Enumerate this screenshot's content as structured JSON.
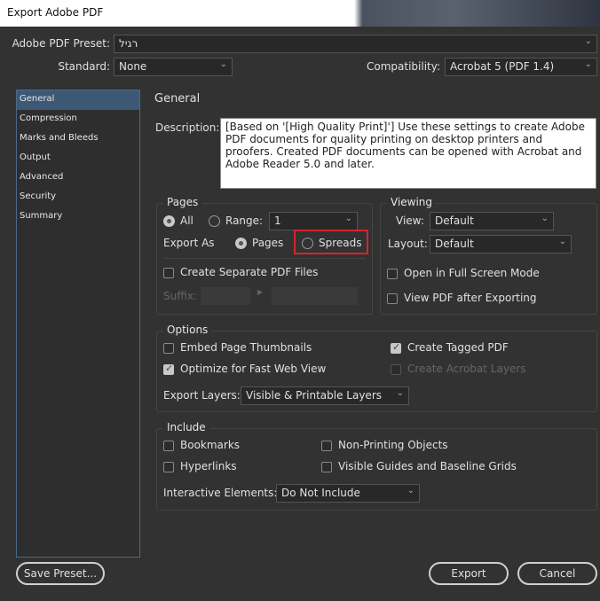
{
  "window": {
    "title": "Export Adobe PDF"
  },
  "preset": {
    "label": "Adobe PDF Preset:",
    "value": "רגיל"
  },
  "standard": {
    "label": "Standard:",
    "value": "None"
  },
  "compatibility": {
    "label": "Compatibility:",
    "value": "Acrobat 5 (PDF 1.4)"
  },
  "sidebar": {
    "items": [
      {
        "label": "General",
        "selected": true
      },
      {
        "label": "Compression"
      },
      {
        "label": "Marks and Bleeds"
      },
      {
        "label": "Output"
      },
      {
        "label": "Advanced"
      },
      {
        "label": "Security"
      },
      {
        "label": "Summary"
      }
    ]
  },
  "general": {
    "heading": "General",
    "description_label": "Description:",
    "description": "[Based on '[High Quality Print]'] Use these settings to create Adobe PDF documents for quality printing on desktop printers and proofers. Created PDF documents can be opened with Acrobat and Adobe Reader 5.0 and later."
  },
  "pages": {
    "title": "Pages",
    "all": "All",
    "range": "Range:",
    "range_value": "1",
    "export_as": "Export As",
    "pages": "Pages",
    "spreads": "Spreads",
    "separate": "Create Separate PDF Files",
    "suffix": "Suffix:"
  },
  "viewing": {
    "title": "Viewing",
    "view_label": "View:",
    "view_value": "Default",
    "layout_label": "Layout:",
    "layout_value": "Default",
    "fullscreen": "Open in Full Screen Mode",
    "view_after": "View PDF after Exporting"
  },
  "options": {
    "title": "Options",
    "embed": "Embed Page Thumbnails",
    "optimize": "Optimize for Fast Web View",
    "tagged": "Create Tagged PDF",
    "acrobat_layers": "Create Acrobat Layers",
    "export_layers_label": "Export Layers:",
    "export_layers_value": "Visible & Printable Layers"
  },
  "include": {
    "title": "Include",
    "bookmarks": "Bookmarks",
    "hyperlinks": "Hyperlinks",
    "nonprinting": "Non-Printing Objects",
    "guides": "Visible Guides and Baseline Grids",
    "interactive_label": "Interactive Elements:",
    "interactive_value": "Do Not Include"
  },
  "buttons": {
    "save_preset": "Save Preset...",
    "export": "Export",
    "cancel": "Cancel"
  },
  "colors": {
    "highlight": "#d9232d",
    "selected": "#3d5875"
  }
}
